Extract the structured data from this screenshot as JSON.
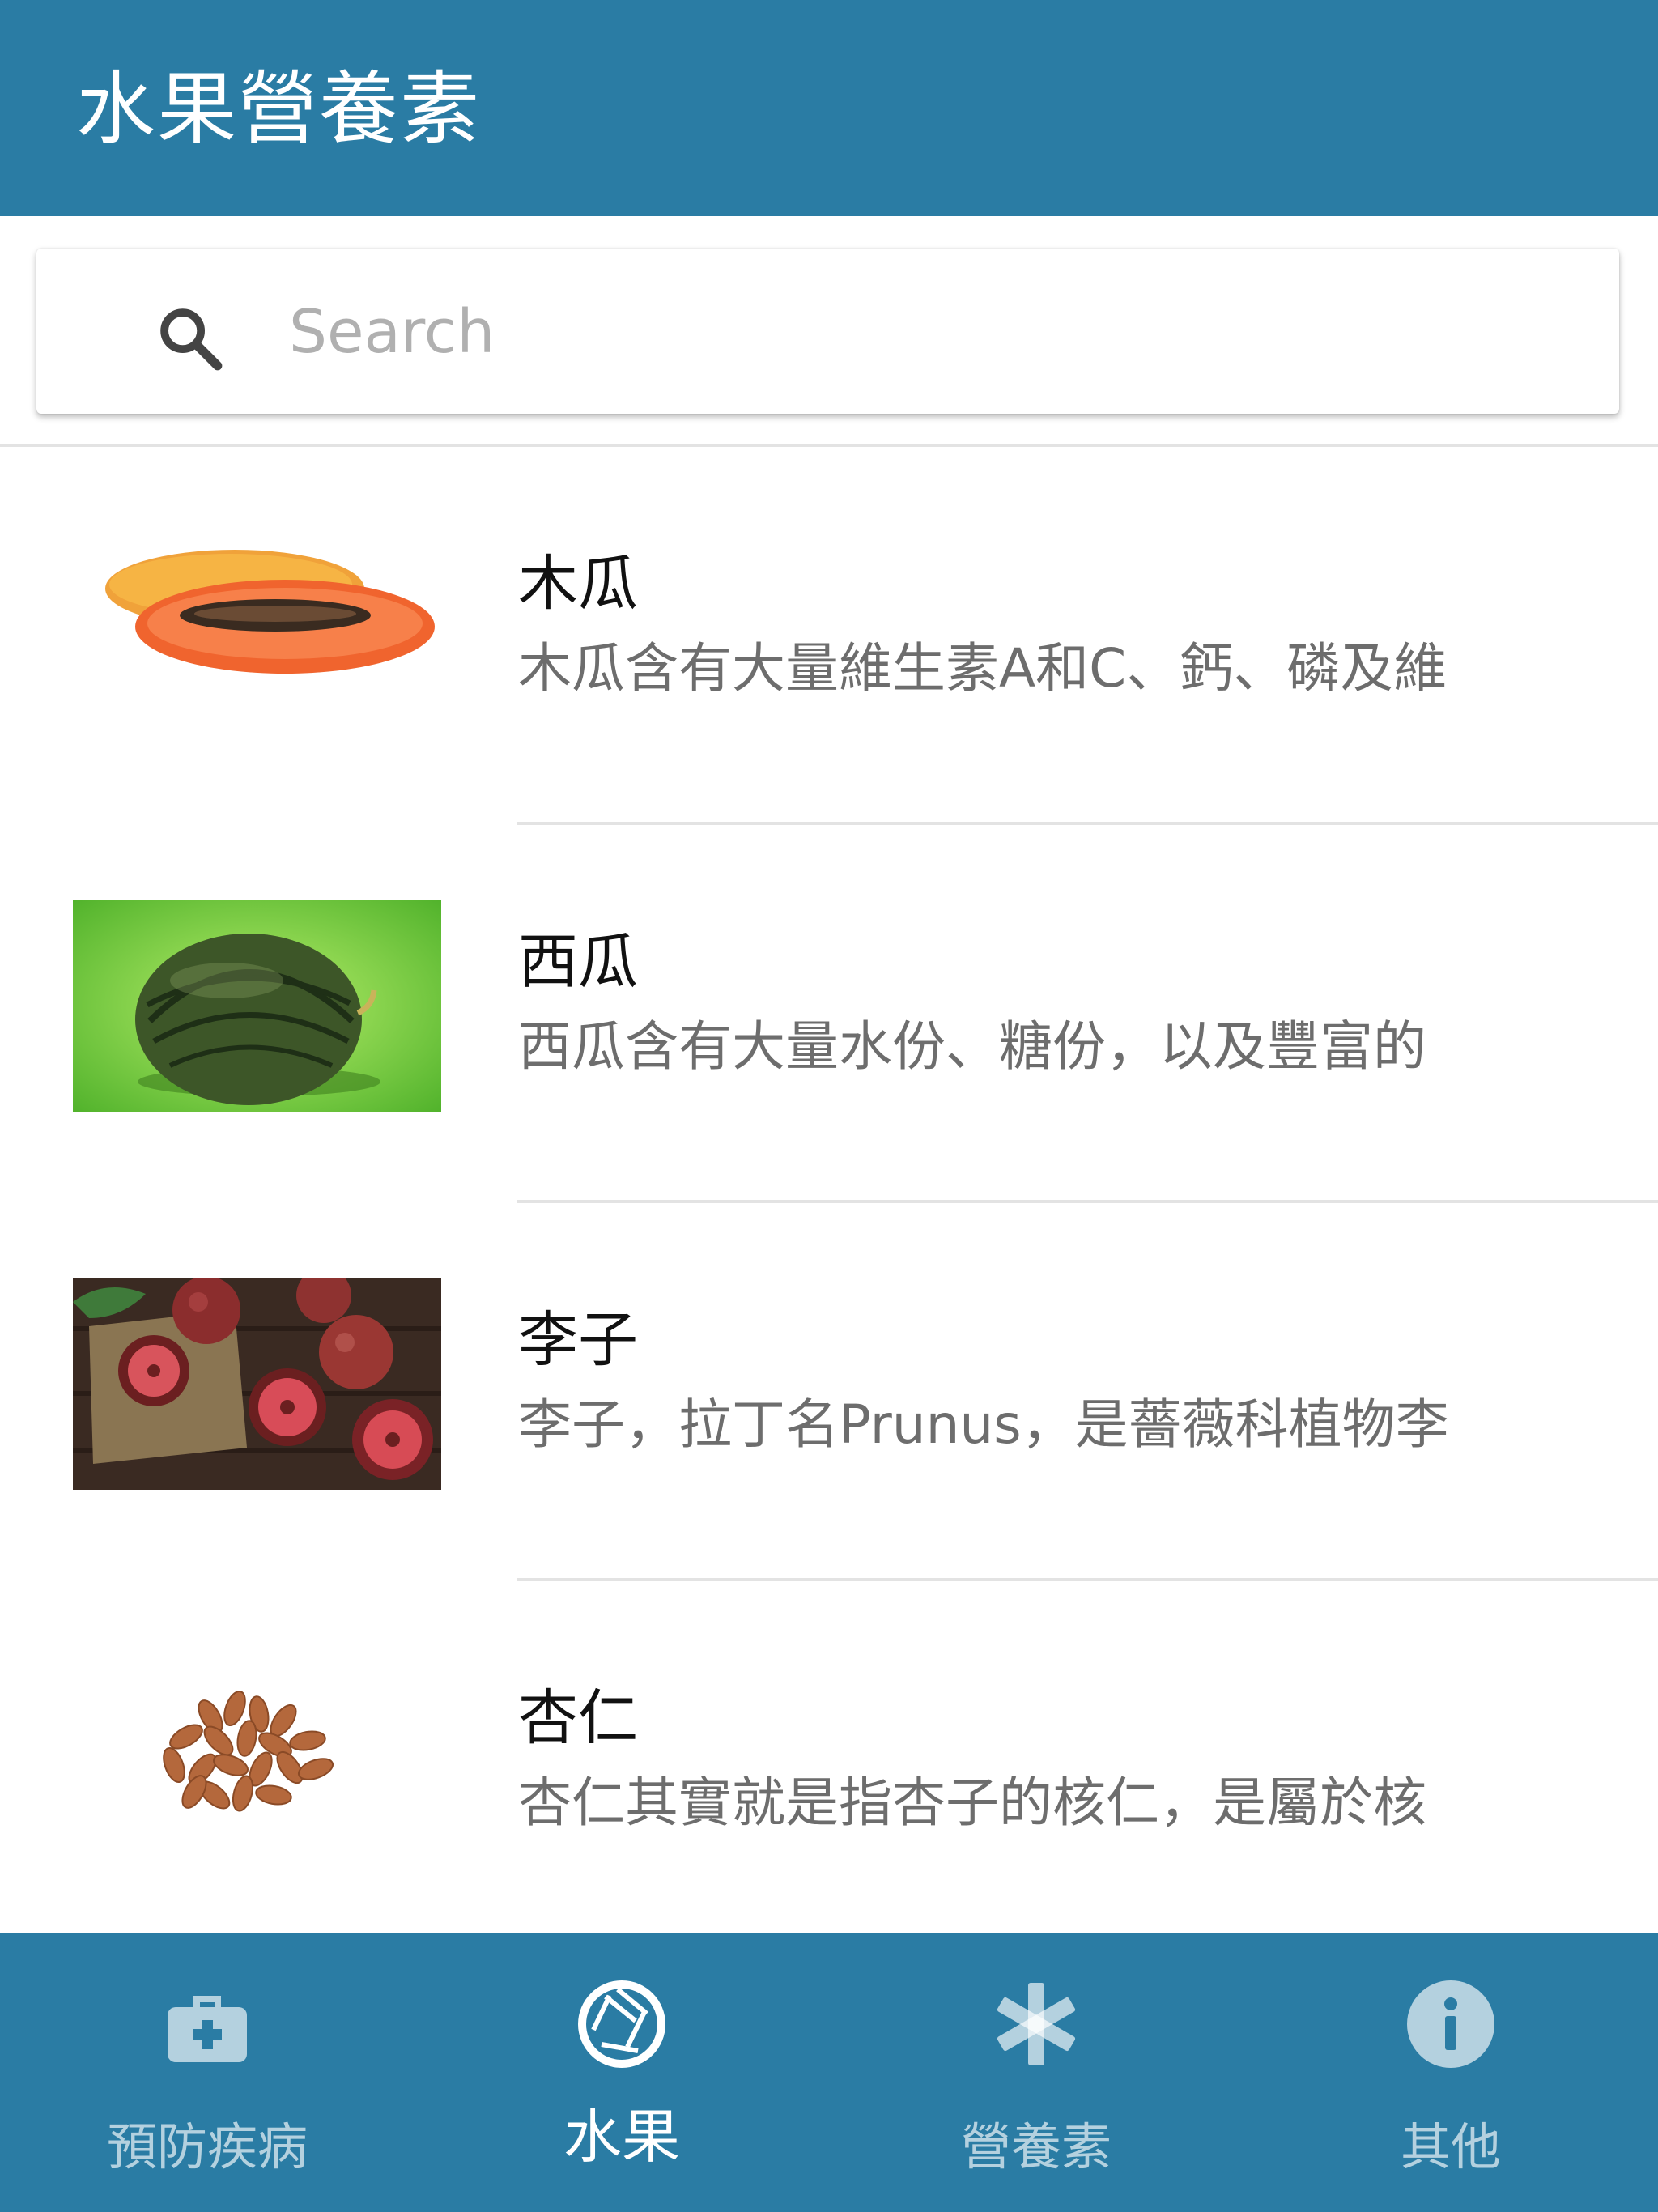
{
  "app": {
    "title": "水果營養素"
  },
  "search": {
    "placeholder": "Search",
    "icon": "search-icon"
  },
  "items": [
    {
      "title": "木瓜",
      "desc": "木瓜含有大量維生素A和C、鈣、磷及維",
      "image": "papaya"
    },
    {
      "title": "西瓜",
      "desc": "西瓜含有大量水份、糖份，以及豐富的",
      "image": "watermelon"
    },
    {
      "title": "李子",
      "desc": "李子，拉丁名Prunus，是薔薇科植物李",
      "image": "plums"
    },
    {
      "title": "杏仁",
      "desc": "杏仁其實就是指杏子的核仁，是屬於核",
      "image": "almonds"
    }
  ],
  "bottom_nav": [
    {
      "label": "預防疾病",
      "icon": "first-aid-kit-icon",
      "active": false
    },
    {
      "label": "水果",
      "icon": "camera-aperture-icon",
      "active": true
    },
    {
      "label": "營養素",
      "icon": "asterisk-icon",
      "active": false
    },
    {
      "label": "其他",
      "icon": "info-icon",
      "active": false
    }
  ],
  "colors": {
    "primary": "#2a7ca4",
    "nav_inactive": "rgba(255,255,255,0.65)",
    "nav_active": "#ffffff",
    "divider": "#e3e3e3",
    "description_text": "#6d6d6d"
  }
}
